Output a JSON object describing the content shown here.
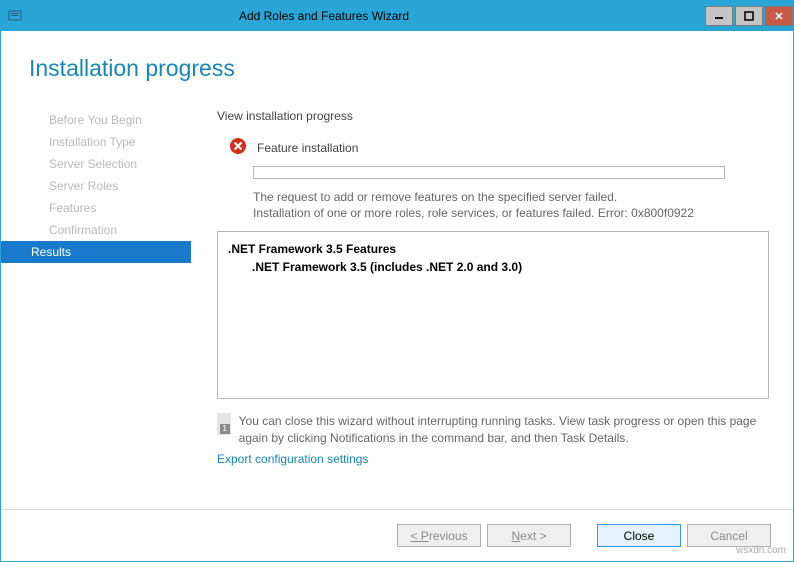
{
  "window": {
    "title": "Add Roles and Features Wizard"
  },
  "heading": "Installation progress",
  "sidebar": {
    "items": [
      {
        "label": "Before You Begin",
        "selected": false
      },
      {
        "label": "Installation Type",
        "selected": false
      },
      {
        "label": "Server Selection",
        "selected": false
      },
      {
        "label": "Server Roles",
        "selected": false
      },
      {
        "label": "Features",
        "selected": false
      },
      {
        "label": "Confirmation",
        "selected": false
      },
      {
        "label": "Results",
        "selected": true
      }
    ]
  },
  "main": {
    "subtitle": "View installation progress",
    "status_label": "Feature installation",
    "error_line1": "The request to add or remove features on the specified server failed.",
    "error_line2": "Installation of one or more roles, role services, or features failed. Error: 0x800f0922",
    "feature_parent": ".NET Framework 3.5 Features",
    "feature_child": ".NET Framework 3.5 (includes .NET 2.0 and 3.0)",
    "info_text": "You can close this wizard without interrupting running tasks. View task progress or open this page again by clicking Notifications in the command bar, and then Task Details.",
    "export_link": "Export configuration settings"
  },
  "footer": {
    "previous": "< Previous",
    "next": "Next >",
    "close": "Close",
    "cancel": "Cancel"
  },
  "watermark": "wsxdn.com"
}
